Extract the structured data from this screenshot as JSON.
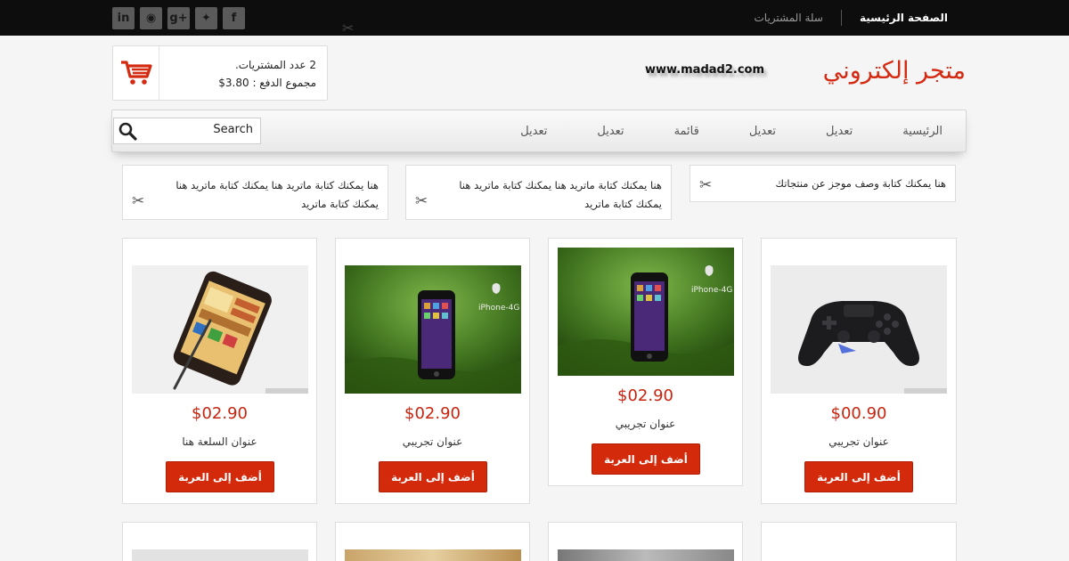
{
  "topbar": {
    "social": [
      {
        "icon": "linkedin-icon",
        "glyph": "in"
      },
      {
        "icon": "rss-icon",
        "glyph": "◉"
      },
      {
        "icon": "google-plus-icon",
        "glyph": "g+"
      },
      {
        "icon": "twitter-icon",
        "glyph": "✦"
      },
      {
        "icon": "facebook-icon",
        "glyph": "f"
      }
    ],
    "nav": {
      "home": "الصفحة الرئيسية",
      "cart": "سلة المشتريات"
    }
  },
  "header": {
    "cart_count": "2 عدد المشتريات.",
    "cart_total": "مجموع الدفع : 3.80$",
    "site_url": "www.madad2.com",
    "site_title": "متجر إلكتروني"
  },
  "navbar": {
    "items": [
      "الرئيسية",
      "تعديل",
      "تعديل",
      "قائمة",
      "تعديل",
      "تعديل"
    ],
    "search_value": "Search"
  },
  "widgets": [
    {
      "text": "هنا يمكنك كتابة وصف موجز عن منتجاتك"
    },
    {
      "text": "هنا يمكنك كتابة ماتريد هنا يمكنك كتابة ماتريد هنا يمكنك كتابة ماتريد"
    },
    {
      "text": "هنا يمكنك كتابة ماتريد هنا يمكنك كتابة ماتريد هنا يمكنك كتابة ماتريد"
    }
  ],
  "products": [
    {
      "price": "$00.90",
      "title": "عنوان تجريبي",
      "button": "أضف إلى العربة",
      "image": "game-controller"
    },
    {
      "price": "$02.90",
      "title": "عنوان تجريبي",
      "button": "أضف إلى العربة",
      "image": "iphone-grass"
    },
    {
      "price": "$02.90",
      "title": "عنوان تجريبي",
      "button": "أضف إلى العربة",
      "image": "iphone-grass"
    },
    {
      "price": "$02.90",
      "title": "عنوان السلعة هنا",
      "button": "أضف إلى العربة",
      "image": "galaxy-note"
    }
  ],
  "colors": {
    "accent": "#d42a12",
    "button": "#d42a0c",
    "topbar": "#0d0d0d"
  }
}
